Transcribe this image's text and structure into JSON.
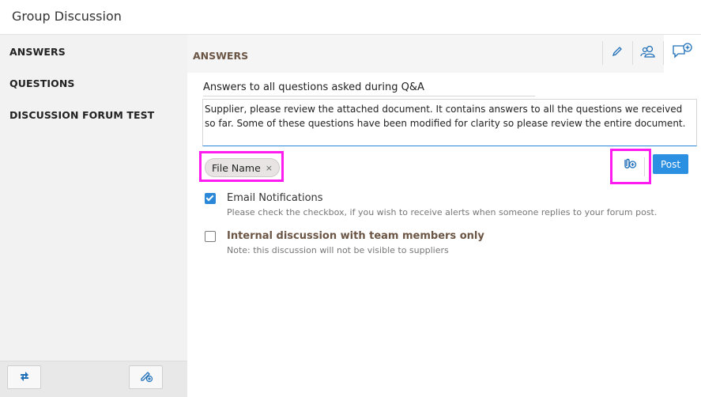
{
  "window": {
    "title": "Group Discussion"
  },
  "sidebar": {
    "items": [
      {
        "label": "ANSWERS"
      },
      {
        "label": "QUESTIONS"
      },
      {
        "label": "DISCUSSION FORUM TEST"
      }
    ],
    "footer_buttons": [
      {
        "icon": "refresh-icon"
      },
      {
        "icon": "new-post-icon"
      }
    ]
  },
  "main": {
    "section_title": "ANSWERS",
    "toolbar": [
      {
        "icon": "edit-icon"
      },
      {
        "icon": "users-icon"
      },
      {
        "icon": "add-discussion-icon"
      }
    ],
    "form": {
      "subject_value": "Answers to all questions asked during Q&A",
      "message_value": "Supplier, please review the attached document. It contains answers to all the questions we received so far. Some of these questions have been modified for clarity so please review the entire document.",
      "attachment": {
        "name": "File Name",
        "remove_glyph": "×"
      },
      "post_label": "Post",
      "attach_icon": "paperclip-plus-icon",
      "options": [
        {
          "label": "Email Notifications",
          "help": "Please check the checkbox, if you wish to receive alerts when someone replies to your forum post.",
          "checked": true
        },
        {
          "label": "Internal discussion with team members only",
          "help": "Note: this discussion will not be visible to suppliers",
          "checked": false
        }
      ]
    }
  },
  "colors": {
    "accent": "#2b88d8",
    "highlight": "#ff1cf0",
    "section_title": "#6b5545"
  }
}
